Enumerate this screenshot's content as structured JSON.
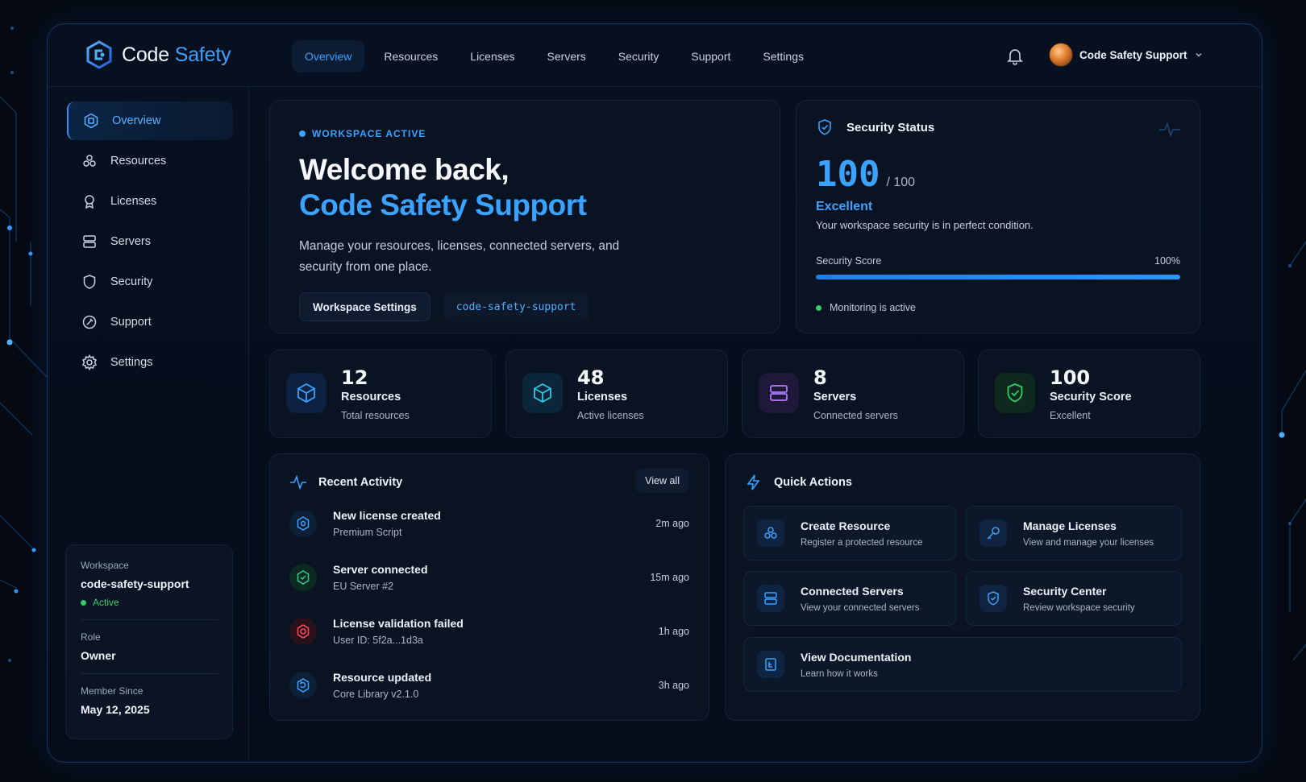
{
  "brand": {
    "name_part1": "Code",
    "name_part2": "Safety"
  },
  "topnav": {
    "items": [
      "Overview",
      "Resources",
      "Licenses",
      "Servers",
      "Security",
      "Support",
      "Settings"
    ],
    "active": "Overview"
  },
  "user": {
    "name": "Code Safety Support"
  },
  "sidebar": {
    "items": [
      {
        "label": "Overview",
        "icon": "overview-icon"
      },
      {
        "label": "Resources",
        "icon": "resources-icon"
      },
      {
        "label": "Licenses",
        "icon": "licenses-icon"
      },
      {
        "label": "Servers",
        "icon": "servers-icon"
      },
      {
        "label": "Security",
        "icon": "shield-icon"
      },
      {
        "label": "Support",
        "icon": "support-icon"
      },
      {
        "label": "Settings",
        "icon": "gear-icon"
      }
    ]
  },
  "workspace_card": {
    "workspace_label": "Workspace",
    "workspace_value": "code-safety-support",
    "status": "Active",
    "role_label": "Role",
    "role_value": "Owner",
    "member_label": "Member Since",
    "member_value": "May 12, 2025"
  },
  "hero": {
    "badge": "WORKSPACE ACTIVE",
    "welcome": "Welcome back,",
    "name": "Code Safety Support",
    "description": "Manage your resources, licenses, connected servers, and security from one place.",
    "settings_button": "Workspace Settings",
    "slug": "code-safety-support"
  },
  "security": {
    "title": "Security Status",
    "score": "100",
    "max": "/ 100",
    "rating": "Excellent",
    "description": "Your workspace security is in perfect condition.",
    "bar_label": "Security Score",
    "bar_value_text": "100%",
    "bar_fraction": 1.0,
    "monitoring": "Monitoring is active"
  },
  "stats": [
    {
      "value": "12",
      "label": "Resources",
      "sub": "Total resources",
      "color": "#3aa2ff"
    },
    {
      "value": "48",
      "label": "Licenses",
      "sub": "Active licenses",
      "color": "#2ec9e6"
    },
    {
      "value": "8",
      "label": "Servers",
      "sub": "Connected servers",
      "color": "#b07cff"
    },
    {
      "value": "100",
      "label": "Security Score",
      "sub": "Excellent",
      "color": "#33cc66"
    }
  ],
  "activity": {
    "title": "Recent Activity",
    "view_all": "View all",
    "items": [
      {
        "title": "New license created",
        "sub": "Premium Script",
        "time": "2m ago",
        "color": "#3aa2ff"
      },
      {
        "title": "Server connected",
        "sub": "EU Server #2",
        "time": "15m ago",
        "color": "#33cc88"
      },
      {
        "title": "License validation failed",
        "sub": "User ID: 5f2a...1d3a",
        "time": "1h ago",
        "color": "#ff4d5e"
      },
      {
        "title": "Resource updated",
        "sub": "Core Library v2.1.0",
        "time": "3h ago",
        "color": "#3aa2ff"
      }
    ]
  },
  "quick_actions": {
    "title": "Quick Actions",
    "items": [
      {
        "title": "Create Resource",
        "sub": "Register a protected resource"
      },
      {
        "title": "Manage Licenses",
        "sub": "View and manage your licenses"
      },
      {
        "title": "Connected Servers",
        "sub": "View your connected servers"
      },
      {
        "title": "Security Center",
        "sub": "Review workspace security"
      },
      {
        "title": "View Documentation",
        "sub": "Learn how it works"
      }
    ]
  }
}
